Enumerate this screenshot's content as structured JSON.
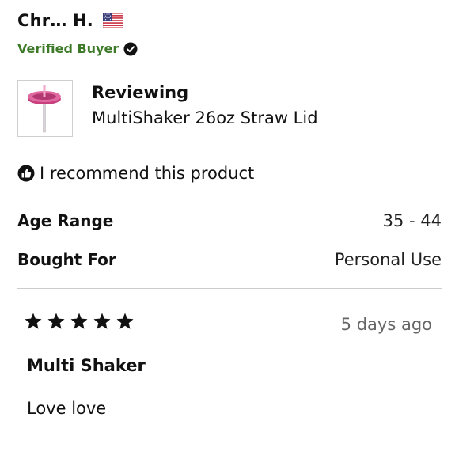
{
  "reviewer": {
    "name": "Chr… H.",
    "flag_icon": "us-flag-icon",
    "badge": "Verified Buyer",
    "badge_color": "#3d7a28"
  },
  "product": {
    "thumb_icon": "straw-lid-product-image",
    "reviewing_label": "Reviewing",
    "name": "MultiShaker 26oz Straw Lid"
  },
  "recommend": {
    "icon": "thumbs-up-icon",
    "text": "I recommend this product"
  },
  "attributes": [
    {
      "label": "Age Range",
      "value": "35 - 44"
    },
    {
      "label": "Bought For",
      "value": "Personal Use"
    }
  ],
  "review": {
    "rating": 5,
    "rating_max": 5,
    "date": "5 days ago",
    "title": "Multi Shaker",
    "body": "Love love"
  }
}
